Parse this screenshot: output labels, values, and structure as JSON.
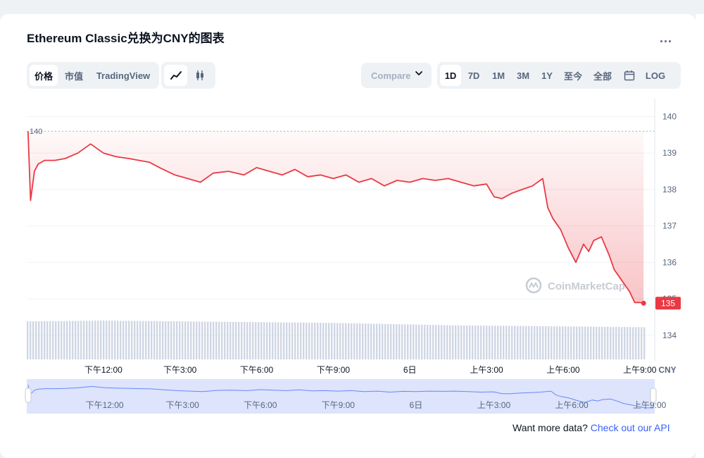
{
  "title": "Ethereum Classic兑换为CNY的图表",
  "more_label": "...",
  "view_tabs": [
    "价格",
    "市值",
    "TradingView"
  ],
  "chart_type_icons": [
    "line-chart-icon",
    "candlestick-icon"
  ],
  "compare": {
    "label": "Compare"
  },
  "ranges": [
    "1D",
    "7D",
    "1M",
    "3M",
    "1Y",
    "至今",
    "全部"
  ],
  "calendar_icon": "calendar-icon",
  "log_label": "LOG",
  "watermark": "CoinMarketCap",
  "footer": {
    "text": "Want more data? ",
    "link": "Check out our API"
  },
  "chart_data": {
    "type": "line",
    "currency": "CNY",
    "open_label": "140",
    "current_label": "135",
    "ylim": [
      133.3,
      140.3
    ],
    "y_ticks": [
      140,
      139,
      138,
      137,
      136,
      135,
      134
    ],
    "x_ticks": [
      "下午12:00",
      "下午3:00",
      "下午6:00",
      "下午9:00",
      "6日",
      "上午3:00",
      "上午6:00",
      "上午9:00"
    ],
    "navigator_ticks": [
      "下午12:00",
      "下午3:00",
      "下午6:00",
      "下午9:00",
      "6日",
      "上午3:00",
      "上午6:00",
      "上午9:00"
    ],
    "x_range_hours": [
      9.0,
      33.2
    ],
    "x_tick_hours": [
      12,
      15,
      18,
      21,
      24,
      27,
      30,
      33
    ],
    "series": [
      {
        "x": [
          9.05,
          9.15,
          9.3,
          9.45,
          9.7,
          10.1,
          10.5,
          11.0,
          11.5,
          12.0,
          12.5,
          13.0,
          13.4,
          13.8,
          14.2,
          14.8,
          15.3,
          15.8,
          16.3,
          16.9,
          17.5,
          18.0,
          18.5,
          19.0,
          19.5,
          20.0,
          20.5,
          21.0,
          21.5,
          22.0,
          22.5,
          23.0,
          23.5,
          24.0,
          24.5,
          25.0,
          25.5,
          26.0,
          26.5,
          27.0,
          27.3,
          27.6,
          28.0,
          28.4,
          28.8,
          29.2,
          29.4,
          29.6,
          29.9,
          30.2,
          30.5,
          30.8,
          31.0,
          31.2,
          31.5,
          31.8,
          32.0,
          32.3,
          32.6,
          32.8,
          33.0,
          33.15
        ],
        "y": [
          139.6,
          137.7,
          138.5,
          138.7,
          138.8,
          138.8,
          138.85,
          139.0,
          139.25,
          139.0,
          138.9,
          138.85,
          138.8,
          138.75,
          138.6,
          138.4,
          138.3,
          138.2,
          138.45,
          138.5,
          138.4,
          138.6,
          138.5,
          138.4,
          138.55,
          138.35,
          138.4,
          138.3,
          138.4,
          138.2,
          138.3,
          138.1,
          138.25,
          138.2,
          138.3,
          138.25,
          138.3,
          138.2,
          138.1,
          138.15,
          137.8,
          137.75,
          137.9,
          138.0,
          138.1,
          138.3,
          137.5,
          137.2,
          136.9,
          136.4,
          136.0,
          136.5,
          136.3,
          136.6,
          136.7,
          136.2,
          135.8,
          135.5,
          135.2,
          134.9,
          134.9,
          134.88
        ]
      }
    ],
    "volume_relative": [
      0.98,
      0.99,
      1.0,
      0.99,
      0.98,
      0.97,
      0.96,
      0.95,
      0.94,
      0.92,
      0.9,
      0.88,
      0.87,
      0.86,
      0.85,
      0.84,
      0.83
    ],
    "legend": "none",
    "grid": true
  },
  "colors": {
    "line": "#ea3943",
    "fill_top": "#ea3943",
    "grid": "#eff2f5",
    "volume": "#cfd6e4",
    "navigator_fill": "#dde4fb",
    "navigator_line": "#3861fb",
    "axis_text": "#58667e"
  }
}
